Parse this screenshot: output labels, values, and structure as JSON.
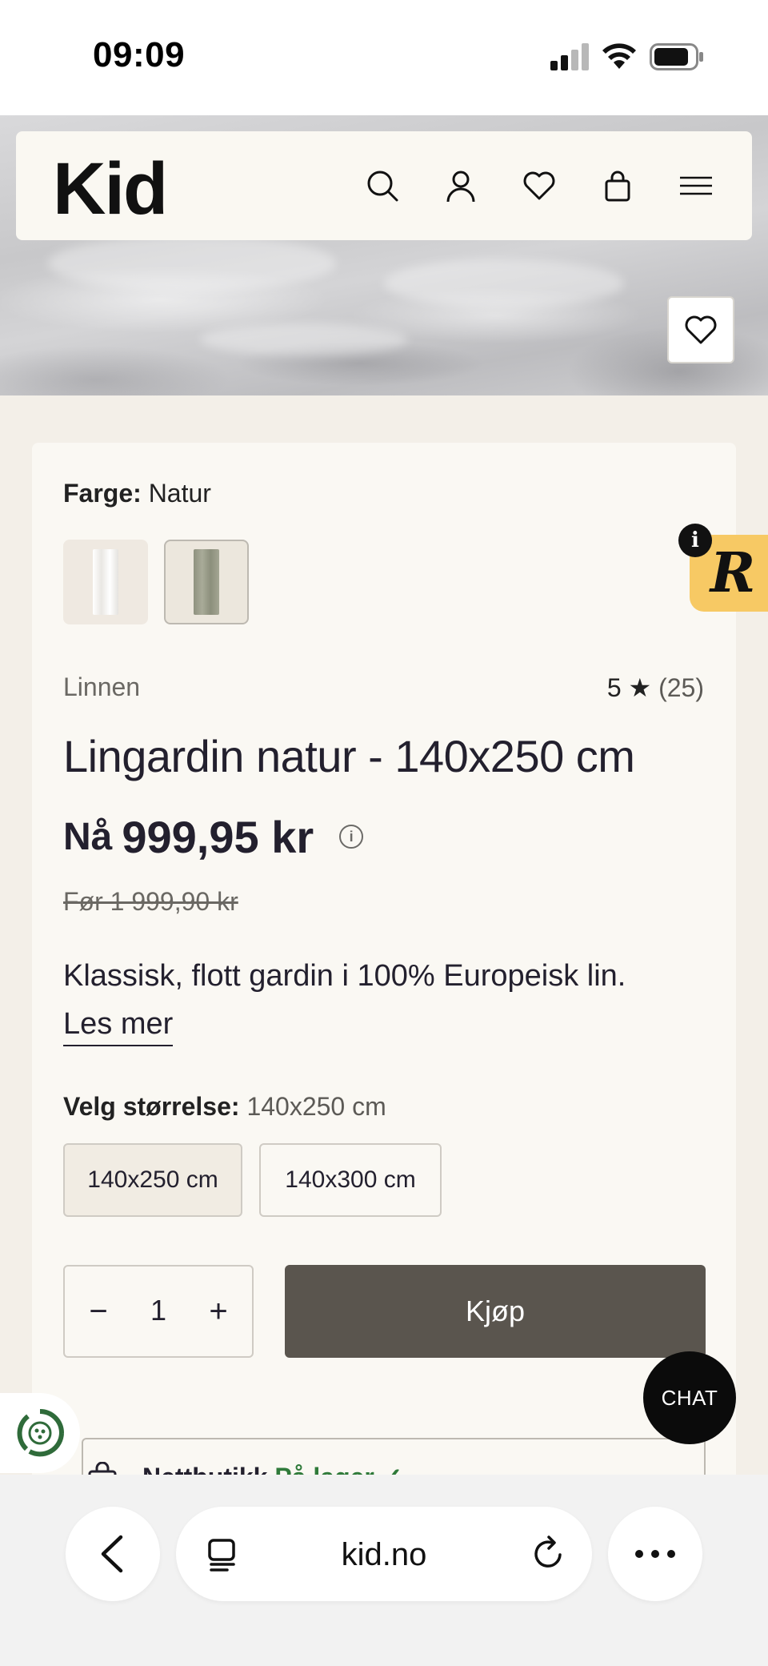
{
  "status_bar": {
    "time": "09:09"
  },
  "header": {
    "logo": "Kid",
    "icons": [
      "search-icon",
      "account-icon",
      "wishlist-heart-icon",
      "shopping-bag-icon",
      "menu-icon"
    ]
  },
  "product": {
    "color_label": "Farge:",
    "color_value": "Natur",
    "swatches": [
      {
        "name": "white-curtain",
        "color": "#f7f5f1"
      },
      {
        "name": "natur-curtain",
        "color": "#9ea08f"
      }
    ],
    "brand": "Linnen",
    "rating_value": "5",
    "rating_star": "★",
    "rating_count": "(25)",
    "title": "Lingardin natur - 140x250 cm",
    "price_prefix": "Nå",
    "price": "999,95 kr",
    "old_price": "Før 1 999,90 kr",
    "description": "Klassisk, flott gardin i 100% Europeisk lin.",
    "read_more": "Les mer",
    "size_label": "Velg størrelse:",
    "size_selected": "140x250 cm",
    "sizes": [
      "140x250 cm",
      "140x300 cm"
    ],
    "quantity": "1",
    "qty_minus": "−",
    "qty_plus": "+",
    "buy_label": "Kjøp",
    "stock_label": "Nettbutikk",
    "stock_status": "På lager ✓"
  },
  "badges": {
    "r_badge": "R",
    "r_info": "i",
    "chat": "CHAT"
  },
  "browser": {
    "url": "kid.no"
  },
  "colors": {
    "buy_button": "#5a554e",
    "card_background": "#faf8f3",
    "page_background": "#f3efe8",
    "badge_yellow": "#f7c964",
    "stock_green": "#2f7a3a"
  }
}
